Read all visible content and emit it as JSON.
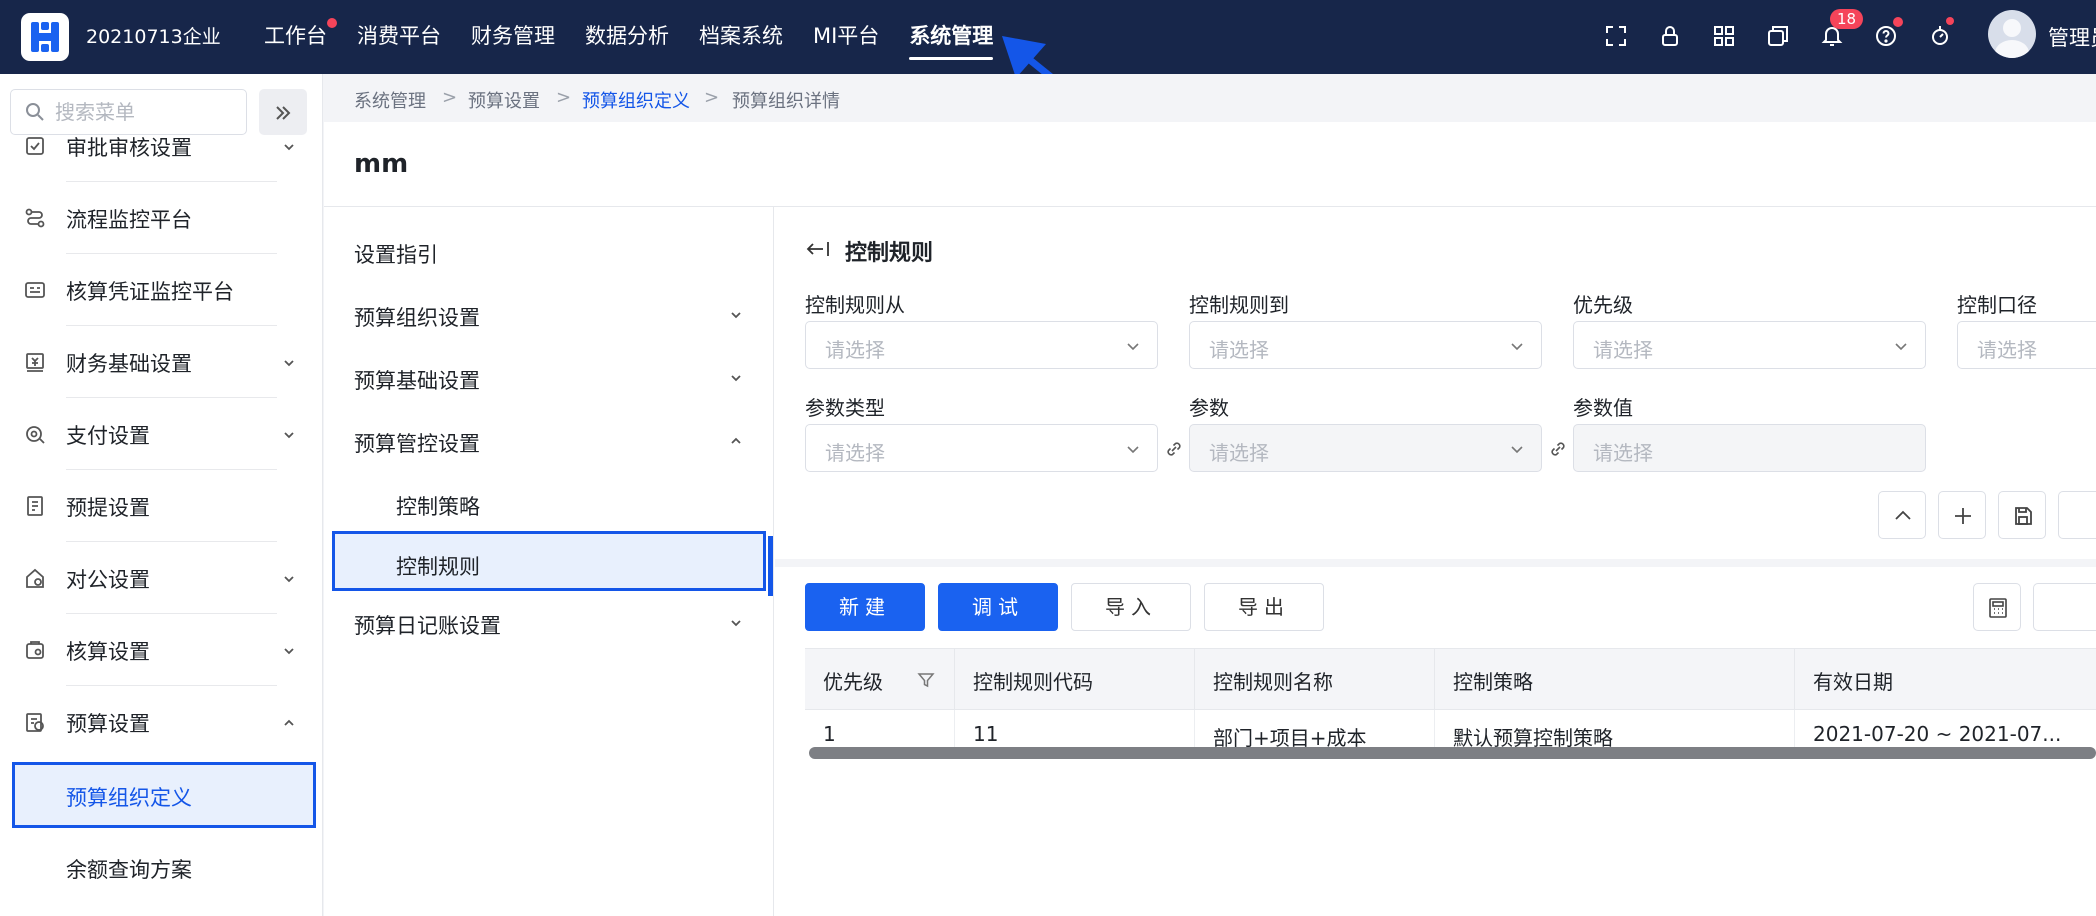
{
  "topbar": {
    "company": "20210713企业",
    "nav": [
      "工作台",
      "消费平台",
      "财务管理",
      "数据分析",
      "档案系统",
      "MI平台",
      "系统管理"
    ],
    "active_nav": "系统管理",
    "notification_count": "18",
    "user_name": "管理员"
  },
  "sidebar": {
    "search_placeholder": "搜索菜单",
    "items": [
      {
        "label": "审批审核设置",
        "icon": "approval-icon"
      },
      {
        "label": "流程监控平台",
        "icon": "flow-icon"
      },
      {
        "label": "核算凭证监控平台",
        "icon": "voucher-icon"
      },
      {
        "label": "财务基础设置",
        "icon": "finance-icon"
      },
      {
        "label": "支付设置",
        "icon": "payment-icon"
      },
      {
        "label": "预提设置",
        "icon": "accrual-icon"
      },
      {
        "label": "对公设置",
        "icon": "corporate-icon"
      },
      {
        "label": "核算设置",
        "icon": "accounting-icon"
      },
      {
        "label": "预算设置",
        "icon": "budget-icon"
      }
    ],
    "sub_items": [
      "预算组织定义",
      "余额查询方案"
    ]
  },
  "breadcrumb": [
    "系统管理",
    "预算设置",
    "预算组织定义",
    "预算组织详情"
  ],
  "page": {
    "title": "mm"
  },
  "subnav": {
    "items": [
      "设置指引",
      "预算组织设置",
      "预算基础设置",
      "预算管控设置",
      "预算日记账设置"
    ],
    "children": [
      "控制策略",
      "控制规则"
    ]
  },
  "form": {
    "section_title": "控制规则",
    "fields": [
      {
        "label": "控制规则从",
        "placeholder": "请选择"
      },
      {
        "label": "控制规则到",
        "placeholder": "请选择"
      },
      {
        "label": "优先级",
        "placeholder": "请选择"
      },
      {
        "label": "控制口径",
        "placeholder": "请选择"
      },
      {
        "label": "参数类型",
        "placeholder": "请选择"
      },
      {
        "label": "参数",
        "placeholder": "请选择"
      },
      {
        "label": "参数值",
        "placeholder": "请选择"
      }
    ]
  },
  "actions": {
    "new": "新建",
    "debug": "调试",
    "import": "导入",
    "export": "导出"
  },
  "table": {
    "columns": [
      "优先级",
      "控制规则代码",
      "控制规则名称",
      "控制策略",
      "有效日期"
    ],
    "rows": [
      [
        "1",
        "11",
        "部门+项目+成本",
        "默认预算控制策略",
        "2021-07-20 ~ 2021-07..."
      ]
    ]
  },
  "colors": {
    "topbar": "#17264a",
    "accent": "#1a62f0",
    "highlight_border": "#1456e8",
    "badge": "#f5445a"
  }
}
